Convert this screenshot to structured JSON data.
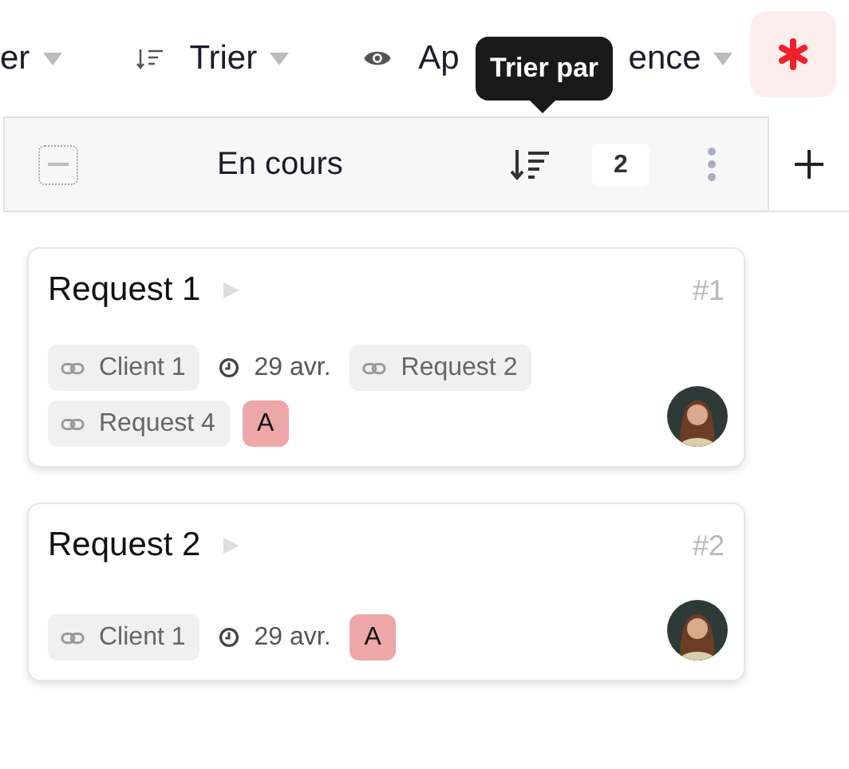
{
  "toolbar": [
    {
      "kind": "filter",
      "label": "er"
    },
    {
      "kind": "sort",
      "label": "Trier"
    },
    {
      "kind": "view",
      "label": "Ap",
      "label_end": "ence"
    }
  ],
  "tooltip": "Trier par",
  "column": {
    "title": "En cours",
    "count": "2"
  },
  "cards": [
    {
      "title": "Request 1",
      "number": "#1",
      "tags": [
        {
          "kind": "link",
          "label": "Client 1"
        },
        {
          "kind": "date",
          "label": "29 avr."
        },
        {
          "kind": "link",
          "label": "Request 2"
        },
        {
          "kind": "link",
          "label": "Request 4"
        },
        {
          "kind": "letter",
          "label": "A"
        }
      ]
    },
    {
      "title": "Request 2",
      "number": "#2",
      "tags": [
        {
          "kind": "link",
          "label": "Client 1"
        },
        {
          "kind": "date",
          "label": "29 avr."
        },
        {
          "kind": "letter",
          "label": "A"
        }
      ]
    }
  ]
}
